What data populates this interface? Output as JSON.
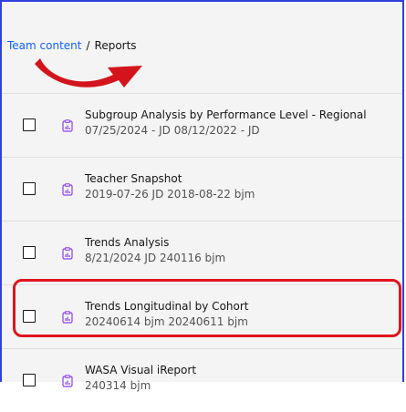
{
  "breadcrumb": {
    "parent": "Team content",
    "separator": "/",
    "current": "Reports"
  },
  "reports": [
    {
      "title": "Subgroup Analysis by Performance Level - Regional",
      "subtitle": "07/25/2024 - JD 08/12/2022 - JD",
      "icon": "report-icon"
    },
    {
      "title": "Teacher Snapshot",
      "subtitle": "2019-07-26 JD 2018-08-22 bjm",
      "icon": "report-icon"
    },
    {
      "title": "Trends Analysis",
      "subtitle": "8/21/2024 JD 240116 bjm",
      "icon": "report-icon"
    },
    {
      "title": "Trends Longitudinal by Cohort",
      "subtitle": "20240614 bjm 20240611 bjm",
      "icon": "report-icon",
      "highlighted": true
    },
    {
      "title": "WASA Visual iReport",
      "subtitle": "240314 bjm",
      "icon": "report-icon"
    }
  ],
  "colors": {
    "link": "#0f62fe",
    "icon": "#8a3ffc",
    "annotation": "#e0141e",
    "frame": "#2f3fe0"
  }
}
